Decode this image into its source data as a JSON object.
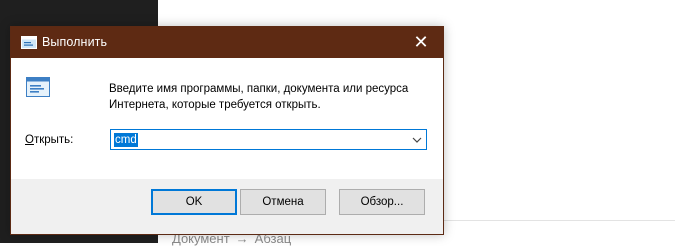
{
  "background": {
    "status_text_1": "Документ",
    "status_arrow": "→",
    "status_text_2": "Абзац"
  },
  "dialog": {
    "title": "Выполнить",
    "close_glyph": "✕",
    "description_line1": "Введите имя программы, папки, документа или ресурса",
    "description_line2": "Интернета, которые требуется открыть.",
    "open_label_accel": "О",
    "open_label_rest": "ткрыть:",
    "open_value": "cmd",
    "buttons": {
      "ok": "OK",
      "cancel": "Отмена",
      "browse": "Обзор..."
    }
  },
  "colors": {
    "titlebar": "#5e2a13",
    "accent": "#0078d7"
  }
}
